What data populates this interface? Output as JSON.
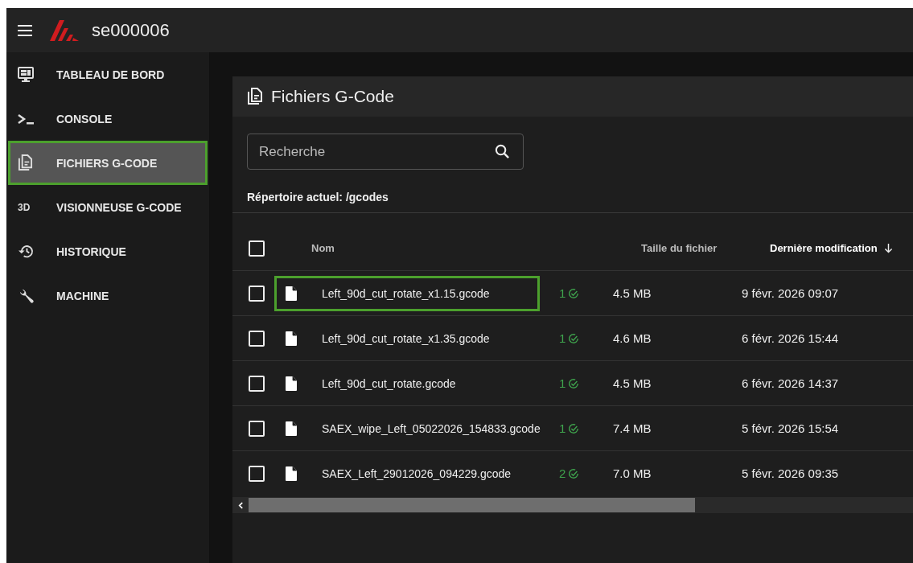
{
  "app_bar": {
    "title": "se000006"
  },
  "sidebar": {
    "items": [
      {
        "label": "TABLEAU DE BORD",
        "selected": false,
        "highlighted": false
      },
      {
        "label": "CONSOLE",
        "selected": false,
        "highlighted": false
      },
      {
        "label": "FICHIERS G-CODE",
        "selected": true,
        "highlighted": true
      },
      {
        "icon_text": "3D",
        "label": "VISIONNEUSE G-CODE",
        "selected": false,
        "highlighted": false
      },
      {
        "label": "HISTORIQUE",
        "selected": false,
        "highlighted": false
      },
      {
        "label": "MACHINE",
        "selected": false,
        "highlighted": false
      }
    ]
  },
  "panel": {
    "title": "Fichiers G-Code",
    "search": {
      "placeholder": "Recherche"
    },
    "current_dir": "Répertoire actuel: /gcodes",
    "table": {
      "columns": [
        {
          "label": "Nom",
          "sorted": false
        },
        {
          "label": "Taille du fichier",
          "sorted": false
        },
        {
          "label": "Dernière modification",
          "sorted": true
        }
      ],
      "all_checked": false,
      "rows": [
        {
          "checked": false,
          "highlighted": true,
          "name": "Left_90d_cut_rotate_x1.15.gcode",
          "prints": "1",
          "size": "4.5 MB",
          "modified": "9 févr. 2026 09:07"
        },
        {
          "checked": false,
          "highlighted": false,
          "name": "Left_90d_cut_rotate_x1.35.gcode",
          "prints": "1",
          "size": "4.6 MB",
          "modified": "6 févr. 2026 15:44"
        },
        {
          "checked": false,
          "highlighted": false,
          "name": "Left_90d_cut_rotate.gcode",
          "prints": "1",
          "size": "4.5 MB",
          "modified": "6 févr. 2026 14:37"
        },
        {
          "checked": false,
          "highlighted": false,
          "name": "SAEX_wipe_Left_05022026_154833.gcode",
          "prints": "1",
          "size": "7.4 MB",
          "modified": "5 févr. 2026 15:54"
        },
        {
          "checked": false,
          "highlighted": false,
          "name": "SAEX_Left_29012026_094229.gcode",
          "prints": "2",
          "size": "7.0 MB",
          "modified": "5 févr. 2026 09:35"
        }
      ]
    }
  }
}
